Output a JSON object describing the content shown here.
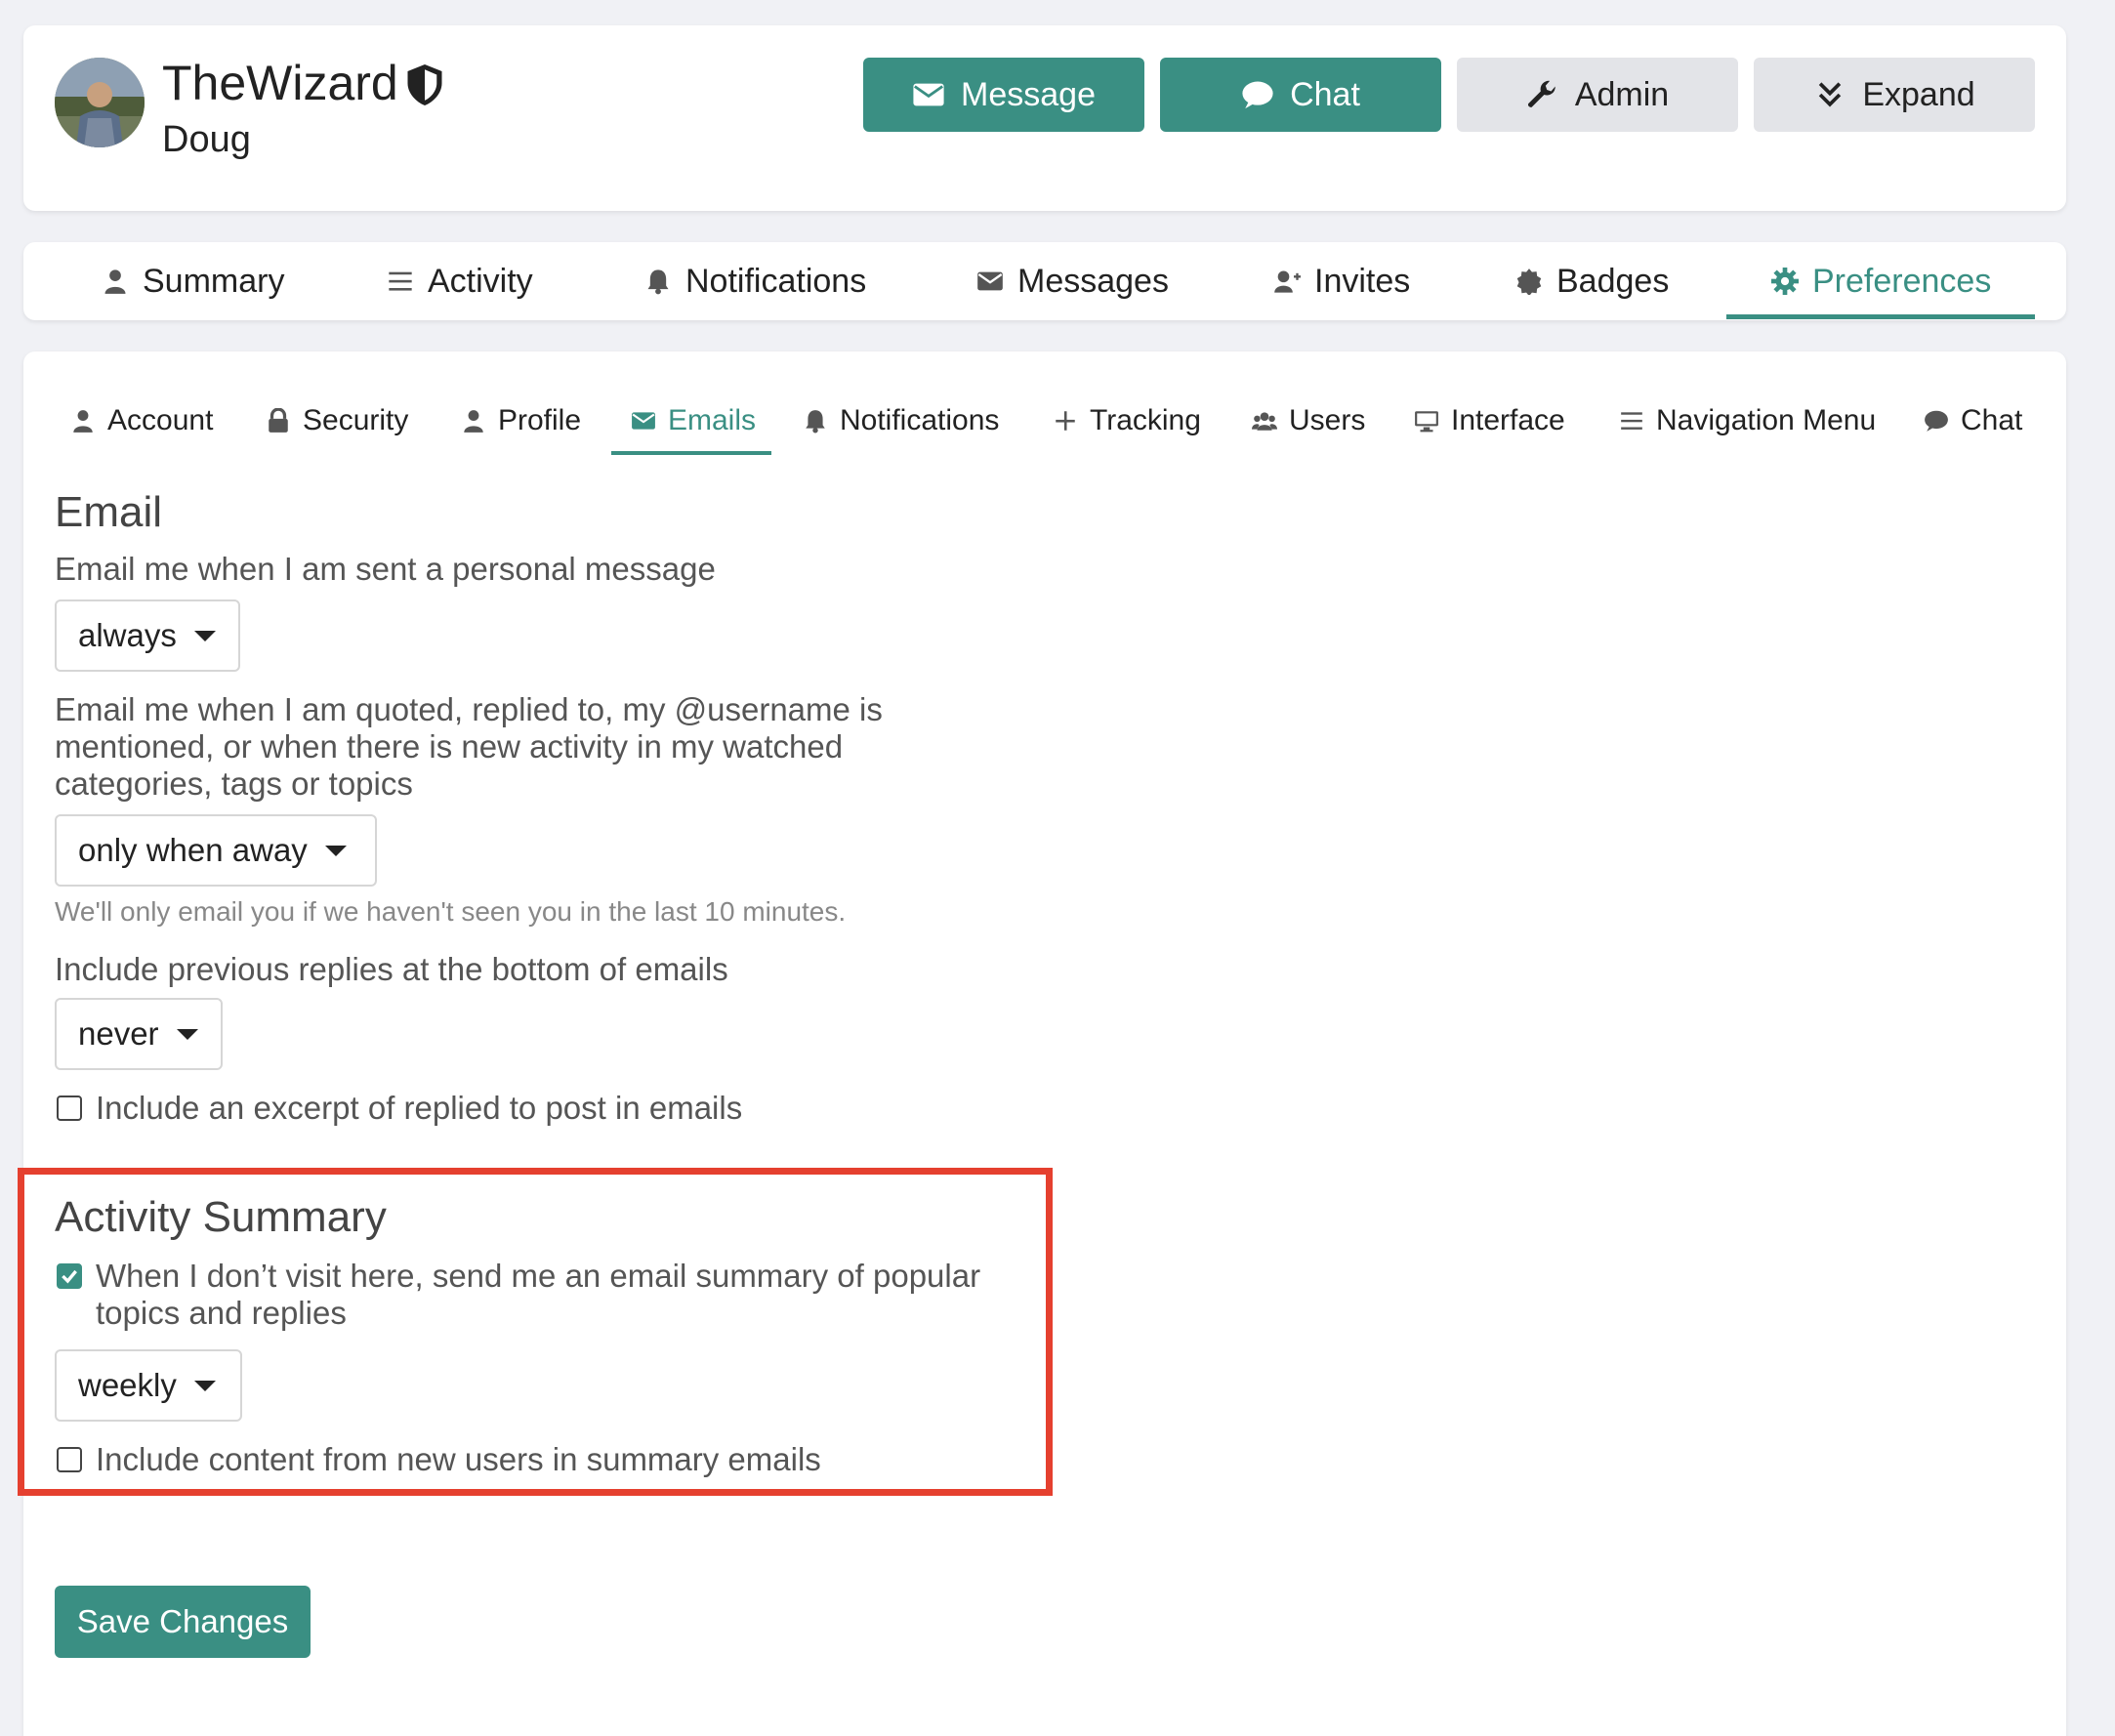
{
  "header": {
    "username": "TheWizard",
    "name": "Doug",
    "buttons": {
      "message": "Message",
      "chat": "Chat",
      "admin": "Admin",
      "expand": "Expand"
    }
  },
  "tabs": {
    "summary": "Summary",
    "activity": "Activity",
    "notifications": "Notifications",
    "messages": "Messages",
    "invites": "Invites",
    "badges": "Badges",
    "preferences": "Preferences",
    "active": "preferences"
  },
  "subtabs": {
    "account": "Account",
    "security": "Security",
    "profile": "Profile",
    "emails": "Emails",
    "notifications": "Notifications",
    "tracking": "Tracking",
    "users": "Users",
    "interface": "Interface",
    "navigation_menu": "Navigation Menu",
    "chat": "Chat",
    "active": "emails"
  },
  "email_section": {
    "title": "Email",
    "personal_message_label": "Email me when I am sent a personal message",
    "personal_message_value": "always",
    "activity_label": "Email me when I am quoted, replied to, my @username is mentioned, or when there is new activity in my watched categories, tags or topics",
    "activity_value": "only when away",
    "activity_hint": "We'll only email you if we haven't seen you in the last 10 minutes.",
    "previous_replies_label": "Include previous replies at the bottom of emails",
    "previous_replies_value": "never",
    "excerpt_label": "Include an excerpt of replied to post in emails",
    "excerpt_checked": false
  },
  "activity_summary": {
    "title": "Activity Summary",
    "digest_label": "When I don’t visit here, send me an email summary of popular topics and replies",
    "digest_checked": true,
    "frequency_value": "weekly",
    "new_users_label": "Include content from new users in summary emails",
    "new_users_checked": false
  },
  "save_label": "Save Changes",
  "colors": {
    "accent": "#3a8f83",
    "highlight": "#e5402f"
  }
}
